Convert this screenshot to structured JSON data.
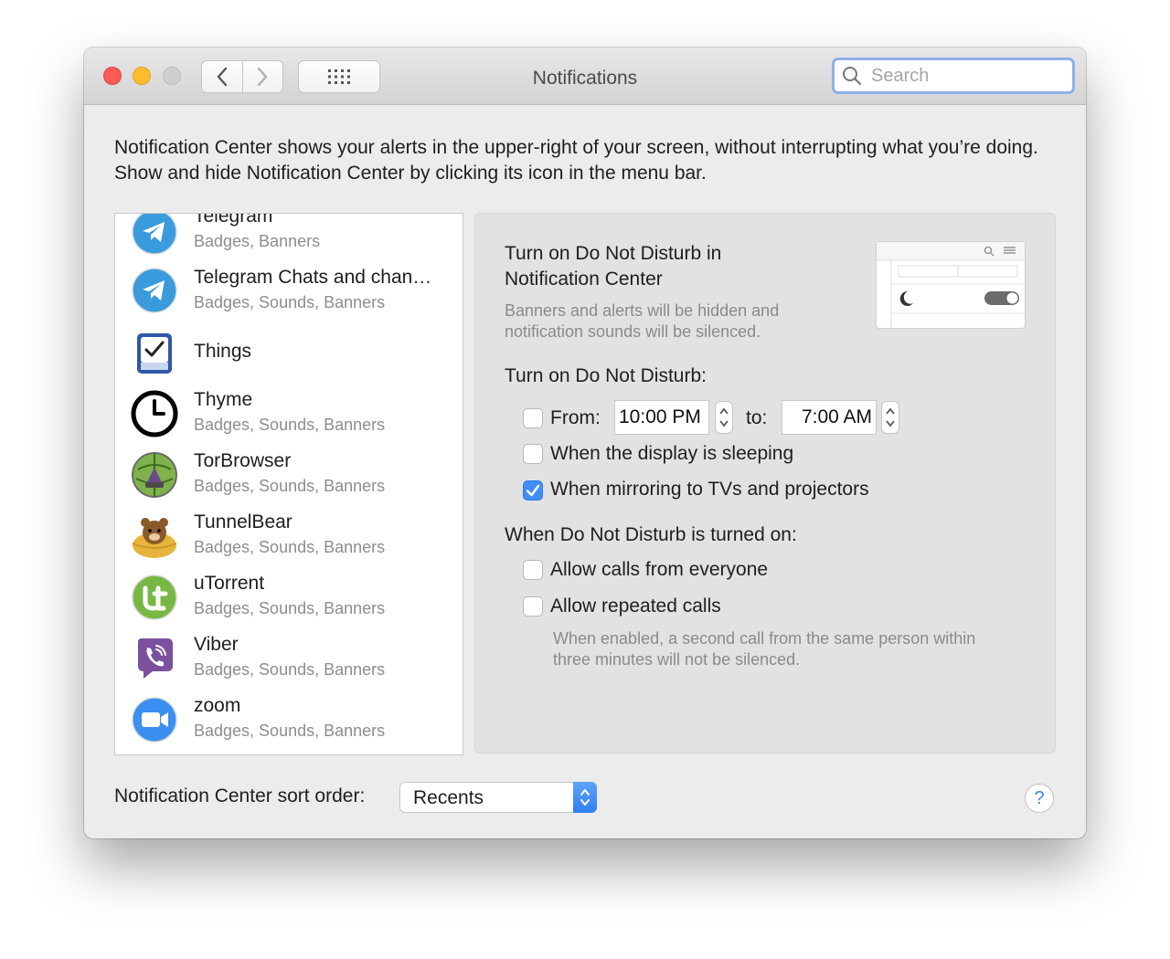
{
  "window": {
    "title": "Notifications"
  },
  "search": {
    "placeholder": "Search"
  },
  "intro": "Notification Center shows your alerts in the upper-right of your screen, without interrupting what you’re doing. Show and hide Notification Center by clicking its icon in the menu bar.",
  "apps": [
    {
      "name": "Telegram",
      "sub": "Badges, Banners",
      "icon": "telegram-icon"
    },
    {
      "name": "Telegram Chats and chan…",
      "sub": "Badges, Sounds, Banners",
      "icon": "telegram-chats-icon"
    },
    {
      "name": "Things",
      "sub": "",
      "icon": "things-icon"
    },
    {
      "name": "Thyme",
      "sub": "Badges, Sounds, Banners",
      "icon": "thyme-clock-icon"
    },
    {
      "name": "TorBrowser",
      "sub": "Badges, Sounds, Banners",
      "icon": "torbrowser-icon"
    },
    {
      "name": "TunnelBear",
      "sub": "Badges, Sounds, Banners",
      "icon": "tunnelbear-icon"
    },
    {
      "name": "uTorrent",
      "sub": "Badges, Sounds, Banners",
      "icon": "utorrent-icon"
    },
    {
      "name": "Viber",
      "sub": "Badges, Sounds, Banners",
      "icon": "viber-icon"
    },
    {
      "name": "zoom",
      "sub": "Badges, Sounds, Banners",
      "icon": "zoom-icon"
    }
  ],
  "dnd": {
    "nc_title_line1": "Turn on Do Not Disturb in",
    "nc_title_line2": "Notification Center",
    "nc_desc_line1": "Banners and alerts will be hidden and",
    "nc_desc_line2": "notification sounds will be silenced.",
    "turn_on_heading": "Turn on Do Not Disturb:",
    "from_label": "From:",
    "from_value": "10:00 PM",
    "to_label": "to:",
    "to_value": "7:00 AM",
    "from_checked": false,
    "display_sleeping_label": "When the display is sleeping",
    "display_sleeping_checked": false,
    "mirroring_label": "When mirroring to TVs and projectors",
    "mirroring_checked": true,
    "when_on_heading": "When Do Not Disturb is turned on:",
    "allow_calls_label": "Allow calls from everyone",
    "allow_calls_checked": false,
    "repeated_calls_label": "Allow repeated calls",
    "repeated_calls_checked": false,
    "repeated_desc_line1": "When enabled, a second call from the same person within",
    "repeated_desc_line2": "three minutes will not be silenced."
  },
  "sort": {
    "label": "Notification Center sort order:",
    "value": "Recents"
  },
  "help": {
    "label": "?"
  },
  "colors": {
    "accent": "#3f8ef7",
    "close": "#fc5b57",
    "minimize": "#fdbc2e"
  }
}
